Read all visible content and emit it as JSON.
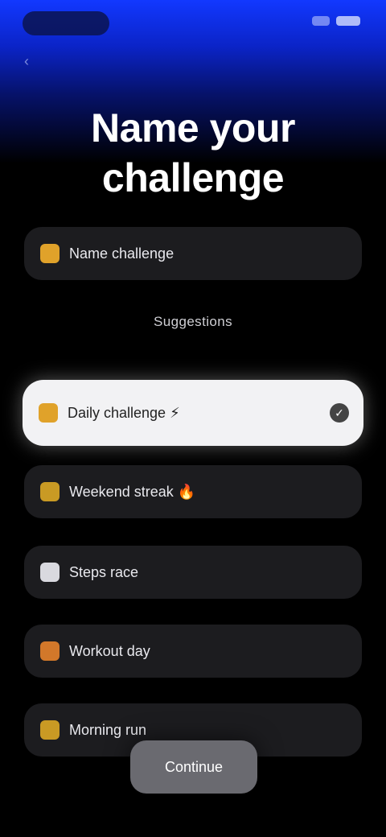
{
  "status_bar": {
    "time_label": "",
    "indicators": [
      "signal-icon",
      "battery-icon"
    ]
  },
  "header": {
    "back_icon": "chevron-left-icon",
    "title_line1": "Name your",
    "title_line2": "challenge"
  },
  "top_option": {
    "label": "Name challenge",
    "icon": "spark-icon",
    "icon_color": "#e0a22a"
  },
  "section": {
    "label": "Suggestions"
  },
  "options": [
    {
      "label": "Daily challenge ⚡",
      "icon": "spark-icon",
      "icon_color": "#e0a22a",
      "selected": true
    },
    {
      "label": "Weekend streak 🔥",
      "icon": "spark-icon",
      "icon_color": "#c99a24",
      "selected": false
    },
    {
      "label": "Steps race",
      "icon": "shoe-icon",
      "icon_color": "#d9d9df",
      "selected": false
    },
    {
      "label": "Workout day",
      "icon": "flame-icon",
      "icon_color": "#d2782a",
      "selected": false
    },
    {
      "label": "Morning run",
      "icon": "spark-icon",
      "icon_color": "#c99a24",
      "selected": false
    }
  ],
  "primary_button": {
    "label": "Continue"
  },
  "colors": {
    "accent_blue": "#1238ff",
    "background": "#000000",
    "card": "#1c1c1f",
    "selected_card": "#f2f2f4"
  }
}
